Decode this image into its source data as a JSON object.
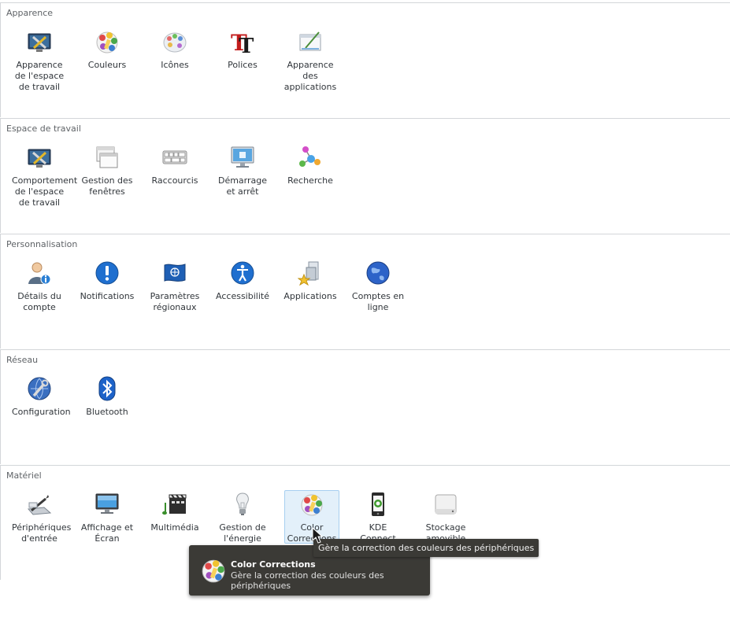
{
  "sections": [
    {
      "title": "Apparence",
      "items": [
        {
          "label": "Apparence de l'espace de travail",
          "icon": "desktop-tools-icon"
        },
        {
          "label": "Couleurs",
          "icon": "color-palette-icon"
        },
        {
          "label": "Icônes",
          "icon": "icons-palette-icon"
        },
        {
          "label": "Polices",
          "icon": "fonts-icon"
        },
        {
          "label": "Apparence des applications",
          "icon": "app-style-icon"
        }
      ]
    },
    {
      "title": "Espace de travail",
      "items": [
        {
          "label": "Comportement de l'espace de travail",
          "icon": "desktop-behavior-icon"
        },
        {
          "label": "Gestion des fenêtres",
          "icon": "windows-icon"
        },
        {
          "label": "Raccourcis",
          "icon": "keyboard-icon"
        },
        {
          "label": "Démarrage et arrêt",
          "icon": "monitor-icon"
        },
        {
          "label": "Recherche",
          "icon": "search-network-icon"
        }
      ]
    },
    {
      "title": "Personnalisation",
      "items": [
        {
          "label": "Détails du compte",
          "icon": "user-info-icon"
        },
        {
          "label": "Notifications",
          "icon": "exclamation-icon"
        },
        {
          "label": "Paramètres régionaux",
          "icon": "flag-icon"
        },
        {
          "label": "Accessibilité",
          "icon": "accessibility-icon"
        },
        {
          "label": "Applications",
          "icon": "applications-icon"
        },
        {
          "label": "Comptes en ligne",
          "icon": "globe-icon"
        }
      ]
    },
    {
      "title": "Réseau",
      "items": [
        {
          "label": "Configuration",
          "icon": "network-config-icon"
        },
        {
          "label": "Bluetooth",
          "icon": "bluetooth-icon"
        }
      ]
    },
    {
      "title": "Matériel",
      "items": [
        {
          "label": "Périphériques d'entrée",
          "icon": "input-devices-icon"
        },
        {
          "label": "Affichage et Écran",
          "icon": "display-icon"
        },
        {
          "label": "Multimédia",
          "icon": "multimedia-icon"
        },
        {
          "label": "Gestion de l'énergie",
          "icon": "lightbulb-icon"
        },
        {
          "label": "Color Corrections",
          "icon": "color-corrections-icon"
        },
        {
          "label": "KDE Connect",
          "icon": "phone-icon"
        },
        {
          "label": "Stockage amovible",
          "icon": "removable-storage-icon"
        }
      ]
    }
  ],
  "tooltip": {
    "text": "Gère la correction des couleurs des périphériques"
  },
  "popup": {
    "title": "Color Corrections",
    "description": "Gère la correction des couleurs des périphériques",
    "icon": "color-corrections-icon"
  }
}
